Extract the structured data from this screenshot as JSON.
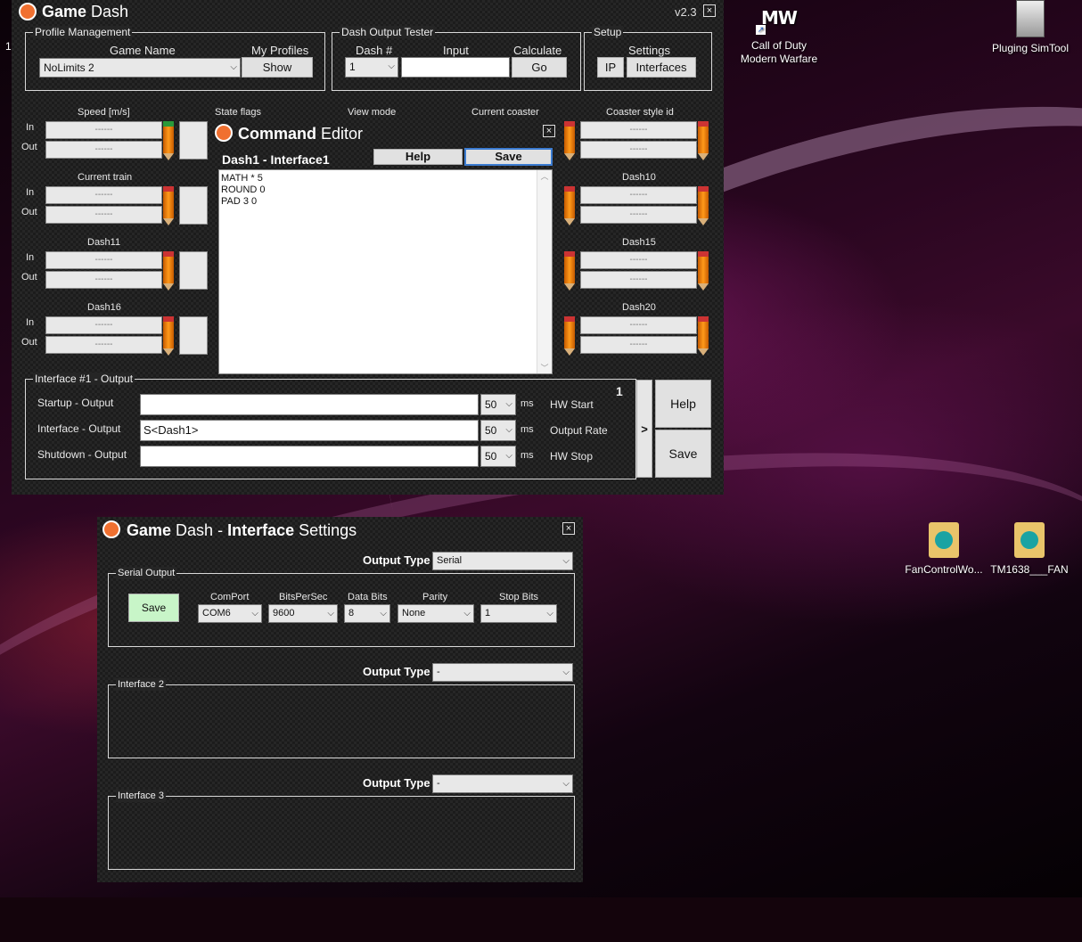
{
  "desktop": {
    "icons": [
      {
        "label": "Call of Duty\nModern Warfare",
        "glyph": "MW"
      },
      {
        "label": "Pluging SimTool"
      },
      {
        "label": "FanControlWo..."
      },
      {
        "label": "TM1638___FAN"
      }
    ],
    "left_edge_text": "1"
  },
  "main": {
    "title_bold": "Game",
    "title_rest": "Dash",
    "version": "v2.3",
    "close": "×",
    "profile": {
      "legend": "Profile Management",
      "game_name_label": "Game Name",
      "game_name_value": "NoLimits 2",
      "my_profiles_label": "My Profiles",
      "show_button": "Show"
    },
    "tester": {
      "legend": "Dash Output Tester",
      "dash_label": "Dash #",
      "dash_value": "1",
      "input_label": "Input",
      "calc_label": "Calculate",
      "go_button": "Go"
    },
    "setup": {
      "legend": "Setup",
      "settings_label": "Settings",
      "ip_button": "IP",
      "interfaces_button": "Interfaces"
    },
    "in_label": "In",
    "out_label": "Out",
    "placeholder_dash": "------",
    "left_groups": [
      "Speed [m/s]",
      "Current train",
      "Dash11",
      "Dash16"
    ],
    "mid_labels": [
      "State flags",
      "View mode",
      "Current coaster"
    ],
    "right_groups": [
      "Coaster style id",
      "Dash10",
      "Dash15",
      "Dash20"
    ],
    "output": {
      "legend": "Interface #1 - Output",
      "badge": "1",
      "rows": [
        {
          "label": "Startup - Output",
          "value": "",
          "ms": "50",
          "unit": "ms",
          "hw": "HW Start"
        },
        {
          "label": "Interface - Output",
          "value": "S<Dash1>",
          "ms": "50",
          "unit": "ms",
          "hw": "Output Rate"
        },
        {
          "label": "Shutdown - Output",
          "value": "",
          "ms": "50",
          "unit": "ms",
          "hw": "HW Stop"
        }
      ],
      "arrow_button": ">",
      "help_button": "Help",
      "save_button": "Save"
    }
  },
  "editor": {
    "title_bold": "Command",
    "title_rest": "Editor",
    "close": "×",
    "subtitle": "Dash1 - Interface1",
    "help_button": "Help",
    "save_button": "Save",
    "lines": [
      "MATH * 5",
      "ROUND 0",
      "PAD 3 0"
    ]
  },
  "settings": {
    "title_bold1": "Game",
    "title_mid": "Dash -",
    "title_bold2": "Interface",
    "title_rest": "Settings",
    "close": "×",
    "output_type_label": "Output Type",
    "i1": {
      "output_type": "Serial",
      "legend": "Serial Output",
      "save_button": "Save",
      "comport_label": "ComPort",
      "comport_value": "COM6",
      "bps_label": "BitsPerSec",
      "bps_value": "9600",
      "databits_label": "Data Bits",
      "databits_value": "8",
      "parity_label": "Parity",
      "parity_value": "None",
      "stopbits_label": "Stop Bits",
      "stopbits_value": "1"
    },
    "i2": {
      "output_type": "-",
      "legend": "Interface 2"
    },
    "i3": {
      "output_type": "-",
      "legend": "Interface 3"
    }
  }
}
